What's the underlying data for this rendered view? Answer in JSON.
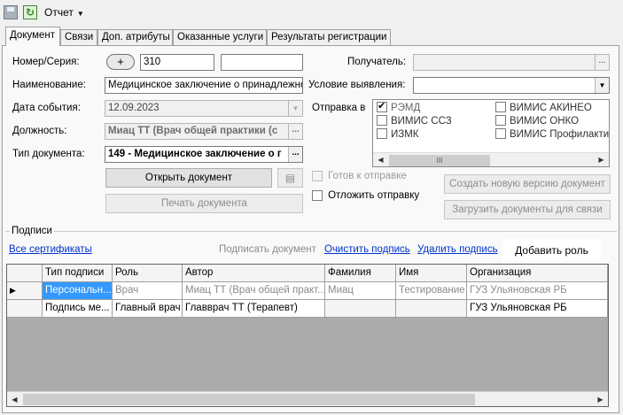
{
  "toolbar": {
    "save_icon": "save-icon",
    "refresh_icon": "refresh-icon",
    "report_menu": "Отчет"
  },
  "tabs": [
    {
      "label": "Документ"
    },
    {
      "label": "Связи"
    },
    {
      "label": "Доп. атрибуты"
    },
    {
      "label": "Оказанные услуги"
    },
    {
      "label": "Результаты регистрации"
    }
  ],
  "form": {
    "number_label": "Номер/Серия:",
    "plus_label": "+",
    "number_value": "310",
    "series_value": "",
    "name_label": "Наименование:",
    "name_value": "Медицинское заключение о принадлежнос",
    "date_label": "Дата события:",
    "date_value": "12.09.2023",
    "position_label": "Должность:",
    "position_value": "Миац ТТ (Врач общей практики (с",
    "doc_type_label": "Тип документа:",
    "doc_type_value": "149 - Медицинское заключение о г",
    "recipient_label": "Получатель:",
    "recipient_value": "",
    "condition_label": "Условие выявления:",
    "condition_value": "",
    "send_to_label": "Отправка в",
    "send_targets": [
      {
        "label": "РЭМД",
        "checked": true
      },
      {
        "label": "ВИМИС АКИНЕО",
        "checked": false
      },
      {
        "label": "ВИМИС ССЗ",
        "checked": false
      },
      {
        "label": "ВИМИС ОНКО",
        "checked": false
      },
      {
        "label": "ИЗМК",
        "checked": false
      },
      {
        "label": "ВИМИС Профилактик",
        "checked": false
      }
    ],
    "ready_to_send_label": "Готов к отправке",
    "postpone_send_label": "Отложить отправку",
    "open_doc_button": "Открыть документ",
    "print_doc_button": "Печать документа",
    "create_version_button": "Создать новую версию документ",
    "load_docs_button": "Загрузить документы для связи"
  },
  "signatures": {
    "group_label": "Подписи",
    "all_certs_link": "Все сертификаты",
    "sign_doc_label": "Подписать документ",
    "clear_sign_link": "Очистить подпись",
    "delete_sign_link": "Удалить подпись",
    "add_role_button": "Добавить роль",
    "columns": [
      "Тип подписи",
      "Роль",
      "Автор",
      "Фамилия",
      "Имя",
      "Организация"
    ],
    "rows": [
      {
        "type": "Персональн...",
        "role": "Врач",
        "author": "Миац ТТ (Врач общей практ...",
        "last_name": "Миац",
        "first_name": "Тестирование",
        "org": "ГУЗ Ульяновская РБ"
      },
      {
        "type": "Подпись ме...",
        "role": "Главный врач",
        "author": "Главврач ТТ (Терапевт)",
        "last_name": "",
        "first_name": "",
        "org": "ГУЗ Ульяновская РБ"
      }
    ],
    "scroll_thumb_label": "III"
  },
  "colors": {
    "selection": "#3399ff",
    "link": "#0033cc",
    "grid_bg": "#ababab"
  }
}
